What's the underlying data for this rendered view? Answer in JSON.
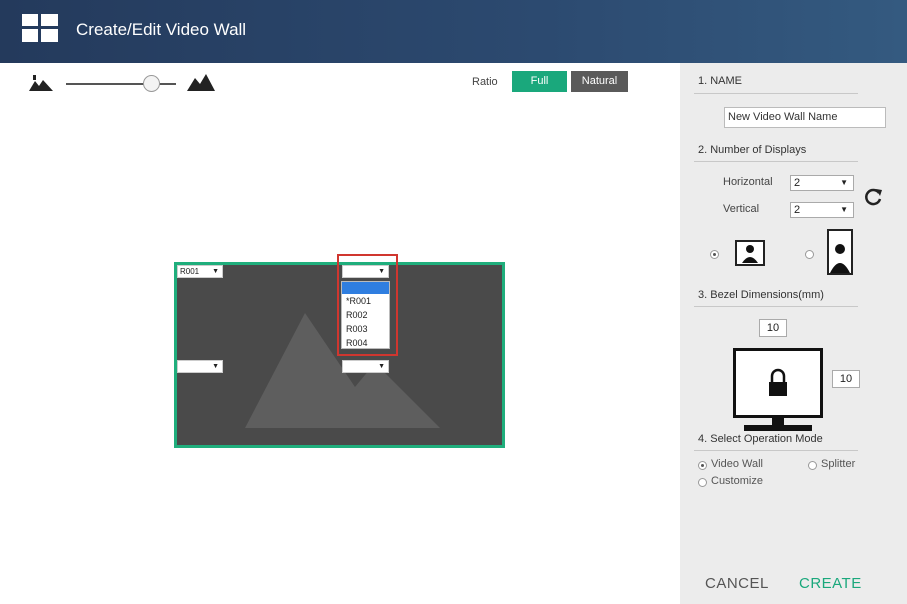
{
  "header": {
    "title": "Create/Edit Video Wall",
    "icon": "video-wall-grid-icon"
  },
  "toolbar": {
    "zoom_min_icon": "small-landscape-icon",
    "zoom_max_icon": "large-landscape-icon",
    "zoom_level": 0.75,
    "ratio_label": "Ratio",
    "ratio_full": "Full",
    "ratio_natural": "Natural",
    "ratio_selected": "Full"
  },
  "wall": {
    "selectors": [
      {
        "value": "R001"
      },
      {
        "value": ""
      },
      {
        "value": ""
      },
      {
        "value": ""
      }
    ],
    "open_dropdown": {
      "options": [
        "*R001",
        "R002",
        "R003",
        "R004"
      ]
    }
  },
  "panel": {
    "name_heading": "1. NAME",
    "name_value": "New Video Wall Name",
    "displays_heading": "2. Number of Displays",
    "horizontal_label": "Horizontal",
    "horizontal_value": "2",
    "vertical_label": "Vertical",
    "vertical_value": "2",
    "orientation_selected": "landscape",
    "bezel_heading": "3. Bezel Dimensions(mm)",
    "bezel_top": "10",
    "bezel_side": "10",
    "mode_heading": "4. Select Operation Mode",
    "mode_video_wall": "Video Wall",
    "mode_splitter": "Splitter",
    "mode_customize": "Customize",
    "mode_selected": "Video Wall",
    "cancel_label": "CANCEL",
    "create_label": "CREATE"
  },
  "colors": {
    "accent": "#1aa87c",
    "header": "#2c4a70",
    "highlight": "#d0362f"
  }
}
